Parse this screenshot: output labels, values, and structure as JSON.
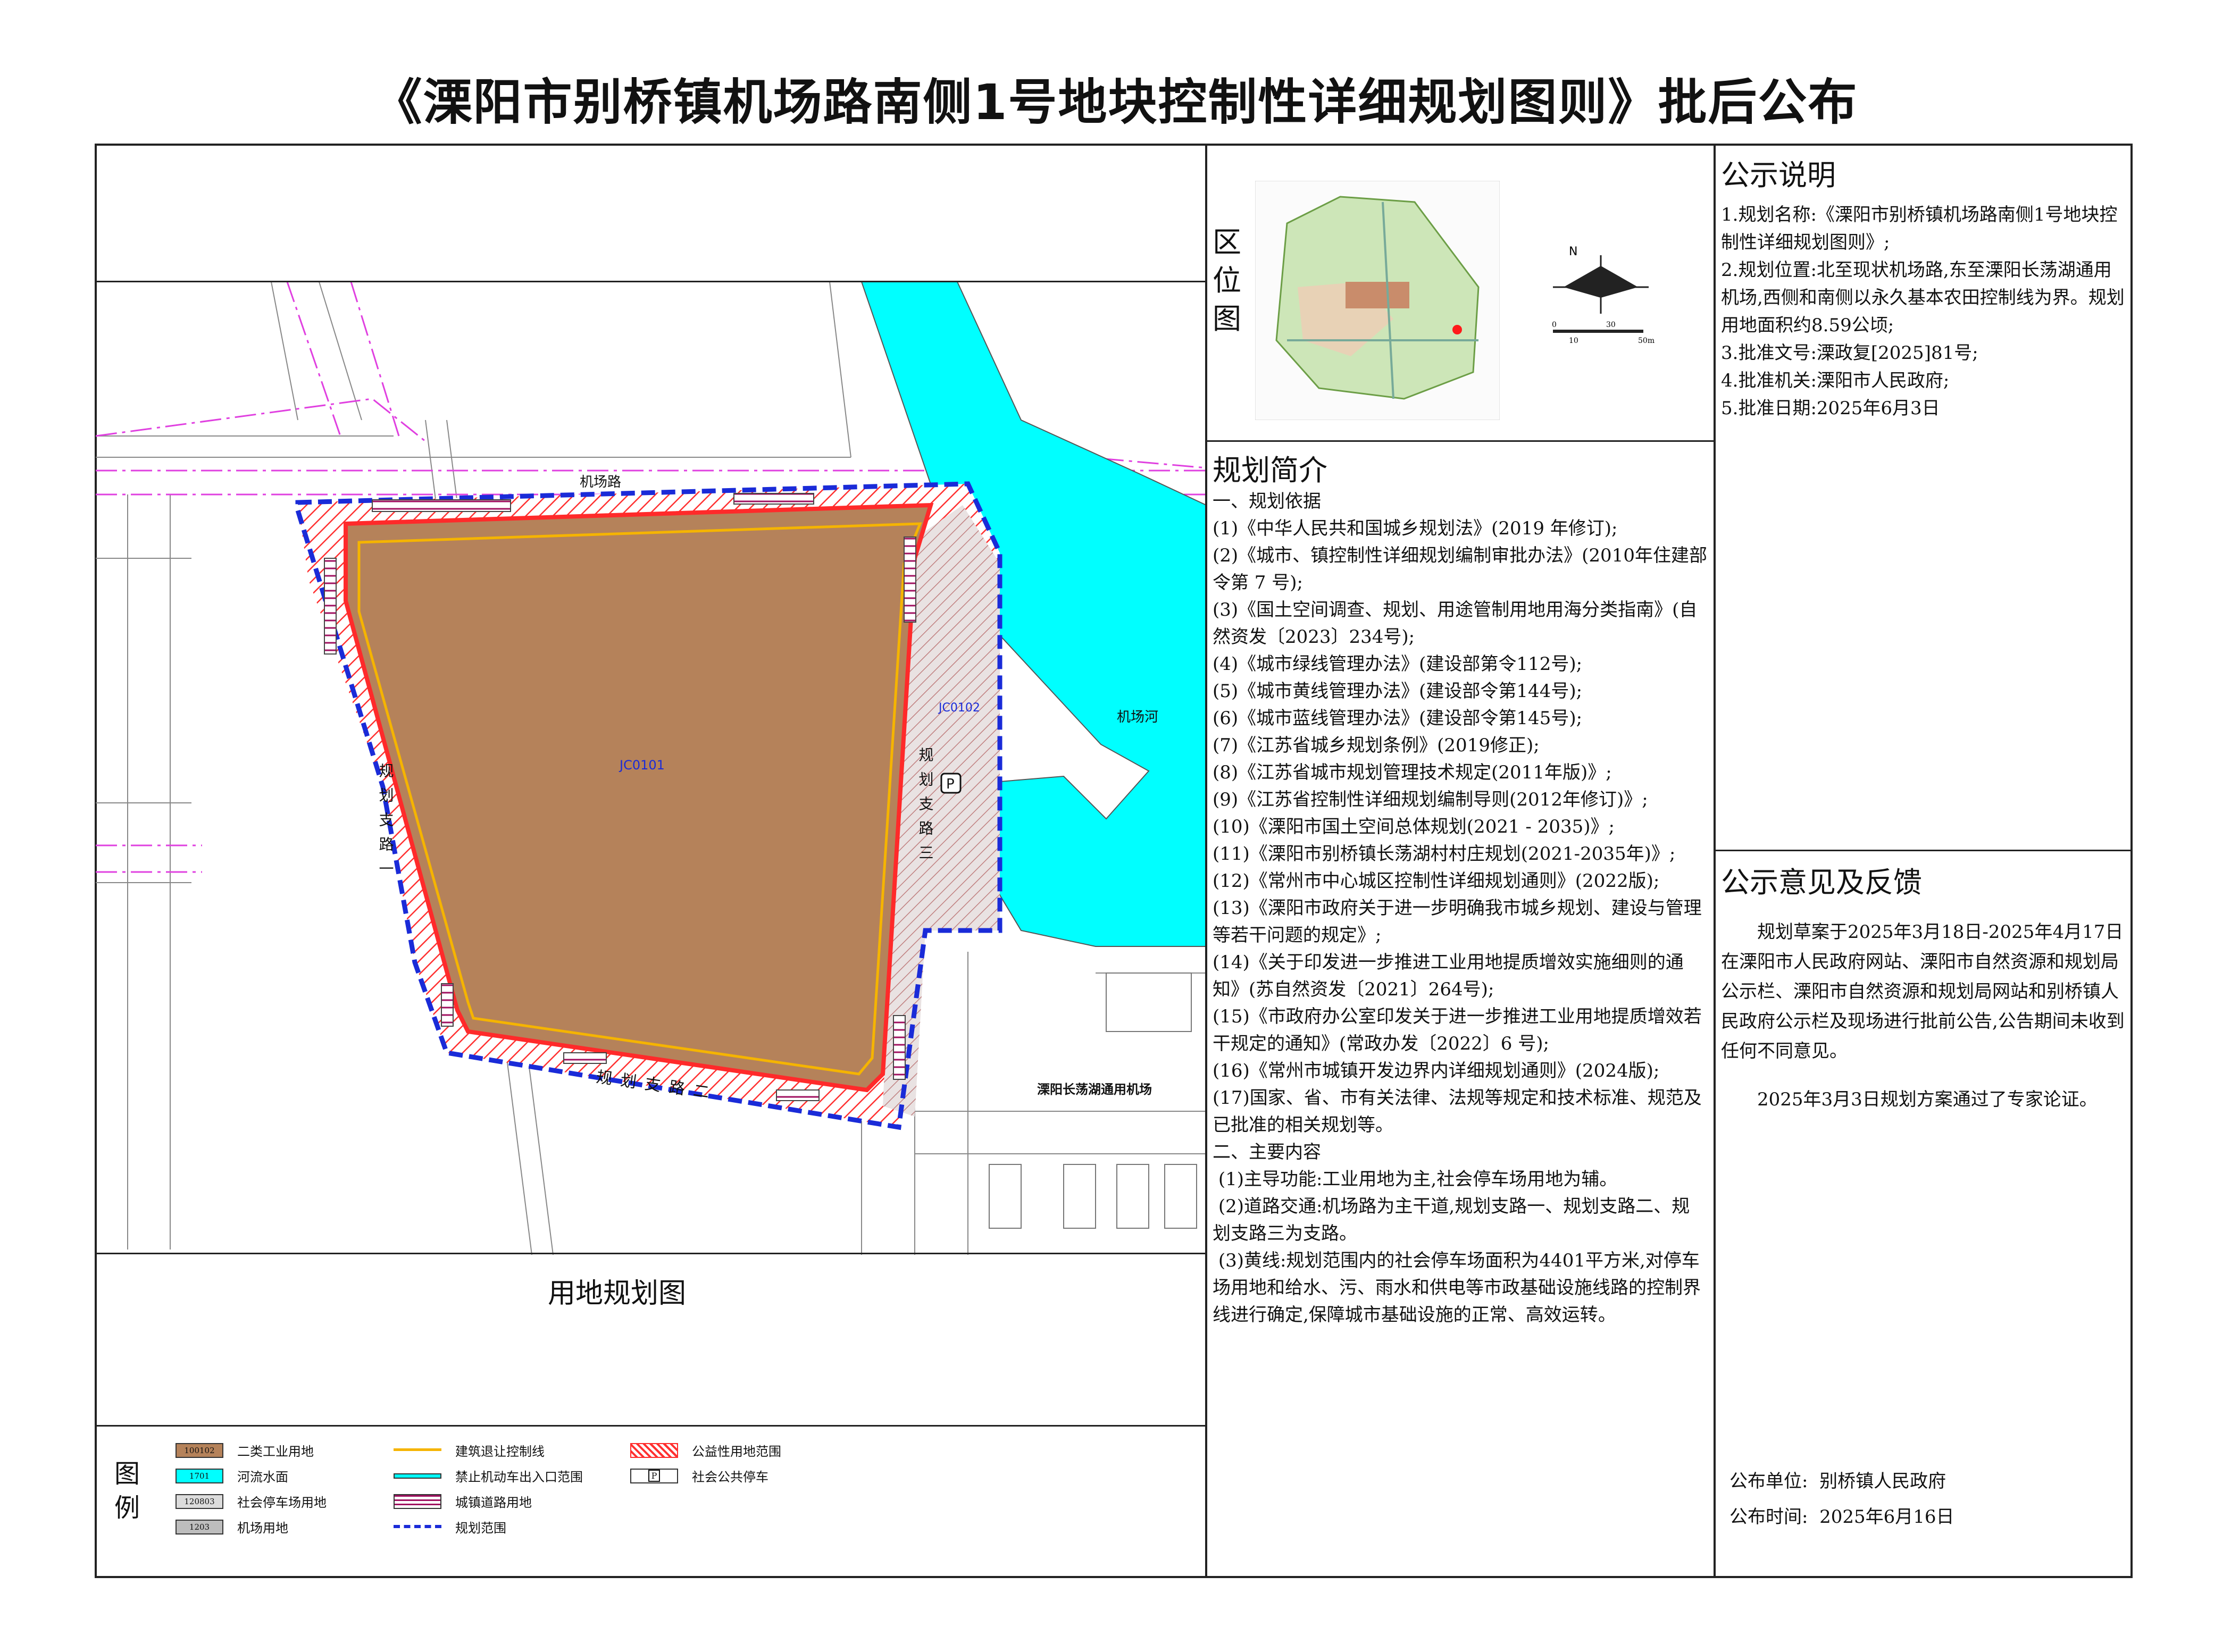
{
  "title": "《溧阳市别桥镇机场路南侧1号地块控制性详细规划图则》批后公布",
  "map": {
    "caption": "用地规划图",
    "labels": {
      "road_airport": "机场路",
      "branch1": "规划支路一",
      "branch2": "规划支路二",
      "branch3": "规划支路三",
      "parcel1": "JC0101",
      "parcel2": "JC0102",
      "river": "机场河",
      "airport": "溧阳长荡湖通用机场",
      "parking": "P"
    },
    "colors": {
      "industrial": "#b5825a",
      "water": "#00ffff",
      "red_line": "#ff2a2a",
      "blue_boundary": "#1a2bd8",
      "setback": "#f5b400",
      "magenta_road": "#e040e0"
    }
  },
  "location": {
    "label": "区位图",
    "north": "N",
    "scale": [
      "0",
      "10",
      "30",
      "50m"
    ]
  },
  "legend": {
    "label": "图例",
    "items": [
      {
        "code": "100102",
        "text": "二类工业用地",
        "color": "#b5825a"
      },
      {
        "code": "1701",
        "text": "河流水面",
        "color": "#00ffff"
      },
      {
        "code": "120803",
        "text": "社会停车场用地",
        "color": "#dcdcdc"
      },
      {
        "code": "1203",
        "text": "机场用地",
        "color": "#bdbdbd"
      },
      {
        "text": "建筑退让控制线",
        "kind": "line-orange"
      },
      {
        "text": "禁止机动车出入口范围",
        "kind": "line-cyan"
      },
      {
        "text": "城镇道路用地",
        "kind": "hatch-magenta"
      },
      {
        "text": "规划范围",
        "kind": "line-blue-dash"
      },
      {
        "text": "公益性用地范围",
        "kind": "hatch-red"
      },
      {
        "text": "社会公共停车",
        "kind": "parking"
      }
    ]
  },
  "notice": {
    "heading": "公示说明",
    "lines": [
      "1.规划名称:《溧阳市别桥镇机场路南侧1号地块控制性详细规划图则》;",
      "2.规划位置:北至现状机场路,东至溧阳长荡湖通用机场,西侧和南侧以永久基本农田控制线为界。规划用地面积约8.59公顷;",
      "3.批准文号:溧政复[2025]81号;",
      "4.批准机关:溧阳市人民政府;",
      "5.批准日期:2025年6月3日"
    ]
  },
  "feedback": {
    "heading": "公示意见及反馈",
    "p1": "规划草案于2025年3月18日-2025年4月17日在溧阳市人民政府网站、溧阳市自然资源和规划局公示栏、溧阳市自然资源和规划局网站和别桥镇人民政府公示栏及现场进行批前公告,公告期间未收到任何不同意见。",
    "p2": "2025年3月3日规划方案通过了专家论证。"
  },
  "publisher": {
    "unit": "公布单位:  别桥镇人民政府",
    "date": "公布时间:  2025年6月16日"
  },
  "intro": {
    "heading": "规划简介",
    "text": "一、规划依据\n(1)《中华人民共和国城乡规划法》(2019 年修订);\n(2)《城市、镇控制性详细规划编制审批办法》(2010年住建部令第 7 号);\n(3)《国土空间调查、规划、用途管制用地用海分类指南》(自然资发〔2023〕234号);\n(4)《城市绿线管理办法》(建设部第令112号);\n(5)《城市黄线管理办法》(建设部令第144号);\n(6)《城市蓝线管理办法》(建设部令第145号);\n(7)《江苏省城乡规划条例》(2019修正);\n(8)《江苏省城市规划管理技术规定(2011年版)》;\n(9)《江苏省控制性详细规划编制导则(2012年修订)》;\n(10)《溧阳市国土空间总体规划(2021 - 2035)》;\n(11)《溧阳市别桥镇长荡湖村村庄规划(2021-2035年)》;\n(12)《常州市中心城区控制性详细规划通则》(2022版);\n(13)《溧阳市政府关于进一步明确我市城乡规划、建设与管理等若干问题的规定》;\n(14)《关于印发进一步推进工业用地提质增效实施细则的通知》(苏自然资发〔2021〕264号);\n(15)《市政府办公室印发关于进一步推进工业用地提质增效若干规定的通知》(常政办发〔2022〕6 号);\n(16)《常州市城镇开发边界内详细规划通则》(2024版);\n(17)国家、省、市有关法律、法规等规定和技术标准、规范及已批准的相关规划等。\n二、主要内容\n (1)主导功能:工业用地为主,社会停车场用地为辅。\n (2)道路交通:机场路为主干道,规划支路一、规划支路二、规划支路三为支路。\n (3)黄线:规划范围内的社会停车场面积为4401平方米,对停车场用地和给水、污、雨水和供电等市政基础设施线路的控制界线进行确定,保障城市基础设施的正常、高效运转。"
  }
}
